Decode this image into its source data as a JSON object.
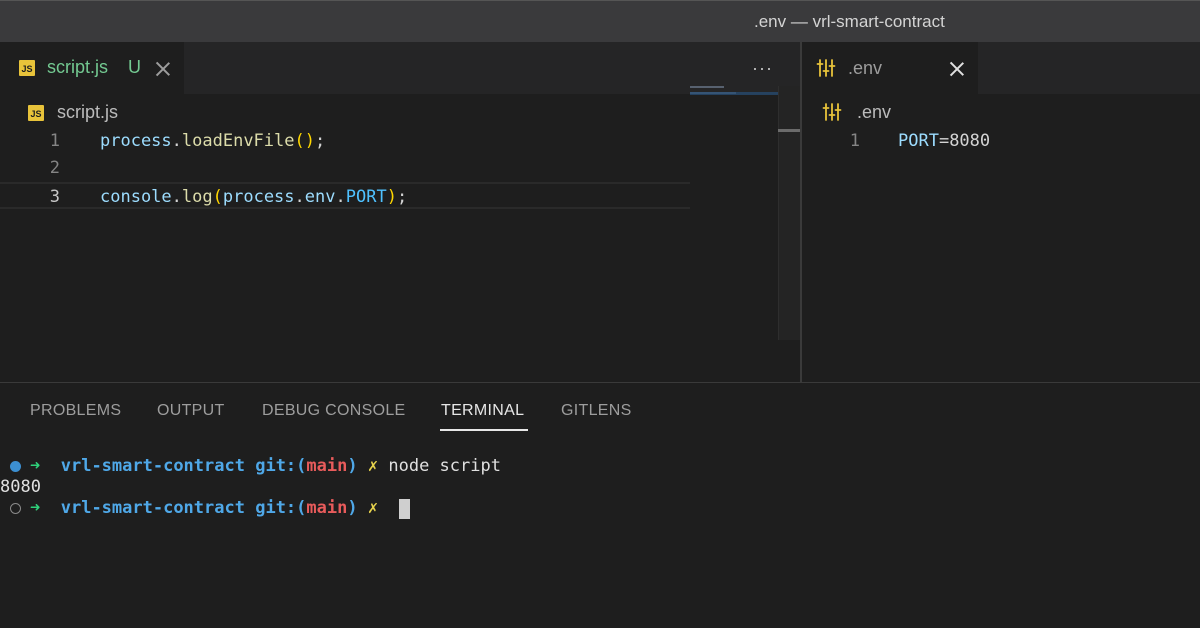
{
  "window": {
    "title": ".env — vrl-smart-contract"
  },
  "left_editor": {
    "tab": {
      "icon": "JS",
      "name": "script.js",
      "status": "U"
    },
    "more_actions": "···",
    "breadcrumb": {
      "icon": "JS",
      "file": "script.js"
    },
    "lines": [
      {
        "number": "1",
        "text": "process.loadEnvFile();"
      },
      {
        "number": "2",
        "text": ""
      },
      {
        "number": "3",
        "text": "console.log(process.env.PORT);"
      }
    ]
  },
  "right_editor": {
    "tab": {
      "icon": "settings-sliders-icon",
      "name": ".env"
    },
    "breadcrumb": {
      "icon": "settings-sliders-icon",
      "file": ".env"
    },
    "lines": [
      {
        "number": "1",
        "text": "PORT=8080"
      }
    ]
  },
  "panel": {
    "tabs": [
      {
        "label": "PROBLEMS",
        "active": false
      },
      {
        "label": "OUTPUT",
        "active": false
      },
      {
        "label": "DEBUG CONSOLE",
        "active": false
      },
      {
        "label": "TERMINAL",
        "active": true
      },
      {
        "label": "GITLENS",
        "active": false
      }
    ],
    "terminal": {
      "prompt_arrow": "➜",
      "directory": "vrl-smart-contract",
      "git_prefix": "git:(",
      "branch": "main",
      "git_suffix": ")",
      "dirty_marker": "✗",
      "command": "node script",
      "output": "8080"
    }
  },
  "colors": {
    "untracked_green": "#73c991",
    "js_badge": "#e8c33a",
    "terminal_arrow": "#2fd17a",
    "terminal_dir": "#4fa8e8",
    "terminal_branch": "#e85b5b",
    "terminal_dirty": "#e8d44d"
  }
}
